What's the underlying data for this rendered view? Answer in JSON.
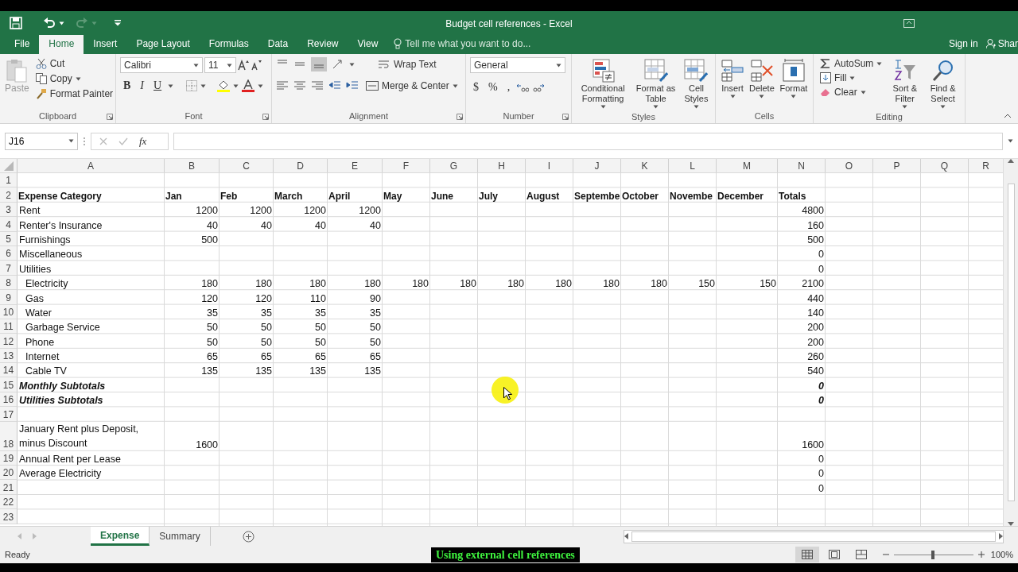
{
  "window": {
    "title": "Budget cell references - Excel"
  },
  "ribbon_tabs": [
    {
      "label": "File",
      "selected": false
    },
    {
      "label": "Home",
      "selected": true
    },
    {
      "label": "Insert",
      "selected": false
    },
    {
      "label": "Page Layout",
      "selected": false
    },
    {
      "label": "Formulas",
      "selected": false
    },
    {
      "label": "Data",
      "selected": false
    },
    {
      "label": "Review",
      "selected": false
    },
    {
      "label": "View",
      "selected": false
    }
  ],
  "tell_me": {
    "placeholder": "Tell me what you want to do..."
  },
  "account": {
    "sign_in": "Sign in",
    "share": "Shar"
  },
  "ribbon": {
    "clipboard": {
      "label": "Clipboard",
      "paste": "Paste",
      "cut": "Cut",
      "copy": "Copy",
      "format_painter": "Format Painter"
    },
    "font": {
      "label": "Font",
      "family": "Calibri",
      "size": "11",
      "style_buttons": [
        "B",
        "I",
        "U"
      ]
    },
    "alignment": {
      "label": "Alignment",
      "wrap_text": "Wrap Text",
      "merge_center": "Merge & Center"
    },
    "number": {
      "label": "Number",
      "format": "General",
      "symbols": [
        "$",
        "%",
        ","
      ]
    },
    "styles": {
      "label": "Styles",
      "buttons": [
        "Conditional Formatting",
        "Format as Table",
        "Cell Styles"
      ]
    },
    "cells": {
      "label": "Cells",
      "buttons": [
        "Insert",
        "Delete",
        "Format"
      ]
    },
    "editing": {
      "label": "Editing",
      "autosum": "AutoSum",
      "fill": "Fill",
      "clear": "Clear",
      "buttons": [
        "Sort & Filter",
        "Find & Select"
      ]
    }
  },
  "formula_bar": {
    "name_box": "J16",
    "function_symbol": "fx"
  },
  "sheet": {
    "columns": [
      "A",
      "B",
      "C",
      "D",
      "E",
      "F",
      "G",
      "H",
      "I",
      "J",
      "K",
      "L",
      "M",
      "N",
      "O",
      "P",
      "Q",
      "R"
    ],
    "rows": [
      {
        "number": "1",
        "kind": "item",
        "cells": {}
      },
      {
        "number": "2",
        "kind": "header",
        "cells": {
          "A": "Expense Category",
          "B": "Jan",
          "C": "Feb",
          "D": "March",
          "E": "April",
          "F": "May",
          "G": "June",
          "H": "July",
          "I": "August",
          "J": "Septembe",
          "K": "October",
          "L": "Novembe",
          "M": "December",
          "N": "Totals"
        }
      },
      {
        "number": "3",
        "kind": "item",
        "cells": {
          "A": "Rent",
          "B": "1200",
          "C": "1200",
          "D": "1200",
          "E": "1200",
          "N": "4800"
        }
      },
      {
        "number": "4",
        "kind": "item",
        "cells": {
          "A": "Renter's Insurance",
          "B": "40",
          "C": "40",
          "D": "40",
          "E": "40",
          "N": "160"
        }
      },
      {
        "number": "5",
        "kind": "item",
        "cells": {
          "A": "Furnishings",
          "B": "500",
          "N": "500"
        }
      },
      {
        "number": "6",
        "kind": "item",
        "cells": {
          "A": "Miscellaneous",
          "N": "0"
        }
      },
      {
        "number": "7",
        "kind": "item",
        "cells": {
          "A": "Utilities",
          "N": "0"
        }
      },
      {
        "number": "8",
        "kind": "subitem",
        "cells": {
          "A": "Electricity",
          "B": "180",
          "C": "180",
          "D": "180",
          "E": "180",
          "F": "180",
          "G": "180",
          "H": "180",
          "I": "180",
          "J": "180",
          "K": "180",
          "L": "150",
          "M": "150",
          "N": "2100"
        }
      },
      {
        "number": "9",
        "kind": "subitem",
        "cells": {
          "A": "Gas",
          "B": "120",
          "C": "120",
          "D": "110",
          "E": "90",
          "N": "440"
        }
      },
      {
        "number": "10",
        "kind": "subitem",
        "cells": {
          "A": "Water",
          "B": "35",
          "C": "35",
          "D": "35",
          "E": "35",
          "N": "140"
        }
      },
      {
        "number": "11",
        "kind": "subitem",
        "cells": {
          "A": "Garbage Service",
          "B": "50",
          "C": "50",
          "D": "50",
          "E": "50",
          "N": "200"
        }
      },
      {
        "number": "12",
        "kind": "subitem",
        "cells": {
          "A": "Phone",
          "B": "50",
          "C": "50",
          "D": "50",
          "E": "50",
          "N": "200"
        }
      },
      {
        "number": "13",
        "kind": "subitem",
        "cells": {
          "A": "Internet",
          "B": "65",
          "C": "65",
          "D": "65",
          "E": "65",
          "N": "260"
        }
      },
      {
        "number": "14",
        "kind": "subitem",
        "cells": {
          "A": "Cable TV",
          "B": "135",
          "C": "135",
          "D": "135",
          "E": "135",
          "N": "540"
        }
      },
      {
        "number": "15",
        "kind": "subtotal",
        "cells": {
          "A": "Monthly Subtotals",
          "N": "0"
        }
      },
      {
        "number": "16",
        "kind": "subtotal",
        "cells": {
          "A": "Utilities Subtotals",
          "N": "0"
        }
      },
      {
        "number": "17",
        "kind": "item",
        "cells": {}
      },
      {
        "number": "18",
        "kind": "wrapped",
        "cells": {
          "A": "January Rent plus Deposit, minus Discount",
          "B": "1600",
          "N": "1600"
        }
      },
      {
        "number": "19",
        "kind": "item",
        "cells": {
          "A": "Annual Rent per Lease",
          "N": "0"
        }
      },
      {
        "number": "20",
        "kind": "item",
        "cells": {
          "A": "Average Electricity",
          "N": "0"
        }
      },
      {
        "number": "21",
        "kind": "item",
        "cells": {
          "N": "0"
        }
      },
      {
        "number": "22",
        "kind": "item",
        "cells": {}
      },
      {
        "number": "23",
        "kind": "item",
        "cells": {}
      }
    ]
  },
  "sheet_tabs": [
    {
      "label": "Expense",
      "selected": true
    },
    {
      "label": "Summary",
      "selected": false
    }
  ],
  "status_bar": {
    "state": "Ready",
    "zoom": "100%"
  },
  "caption": "Using external cell references"
}
